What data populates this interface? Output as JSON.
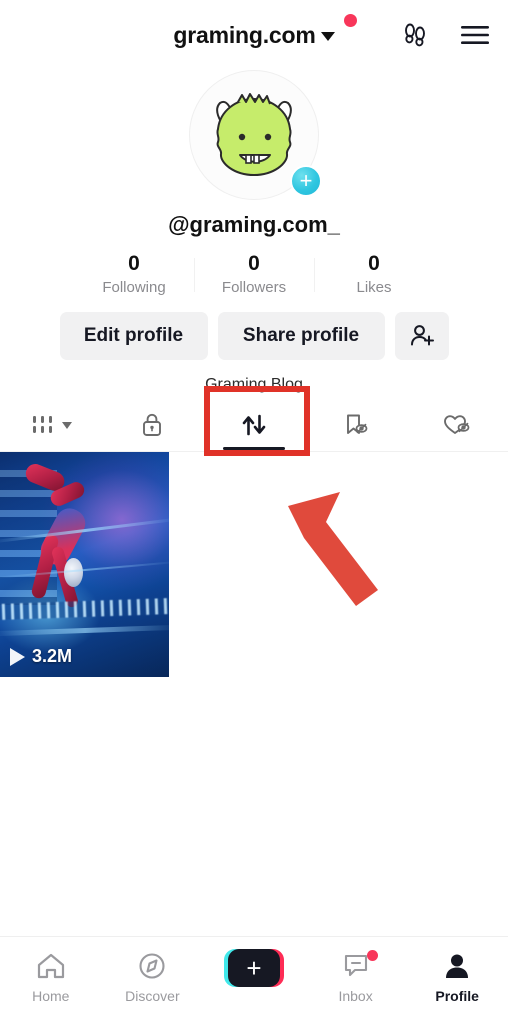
{
  "header": {
    "title": "graming.com",
    "chevron_icon": "chevron-down-icon",
    "notification_dot": true,
    "footprints_icon": "footprints-icon",
    "menu_icon": "hamburger-menu-icon"
  },
  "profile": {
    "avatar_icon": "monster-avatar",
    "add_badge_label": "+",
    "username": "@graming.com_",
    "stats": [
      {
        "value": "0",
        "label": "Following"
      },
      {
        "value": "0",
        "label": "Followers"
      },
      {
        "value": "0",
        "label": "Likes"
      }
    ],
    "actions": {
      "edit_label": "Edit profile",
      "share_label": "Share profile",
      "add_user_icon": "add-person-icon"
    }
  },
  "annotation": {
    "blog_label": "Graming Blog",
    "highlight_color": "#e03228",
    "arrow_color": "#e04a3c",
    "arrow_icon": "red-pointer-arrow"
  },
  "tabs": [
    {
      "id": "posts",
      "icon": "grid-bars-icon",
      "has_caret": true,
      "active": false
    },
    {
      "id": "private",
      "icon": "lock-icon",
      "has_caret": false,
      "active": false
    },
    {
      "id": "reposts",
      "icon": "repost-arrows-icon",
      "has_caret": false,
      "active": true
    },
    {
      "id": "saved",
      "icon": "bookmark-hidden-icon",
      "has_caret": false,
      "active": false
    },
    {
      "id": "liked",
      "icon": "heart-hidden-icon",
      "has_caret": false,
      "active": false
    }
  ],
  "grid": {
    "items": [
      {
        "thumbnail_icon": "spiderman-video-thumbnail",
        "play_count": "3.2M",
        "play_icon": "play-triangle-icon"
      }
    ]
  },
  "bottom_nav": [
    {
      "id": "home",
      "label": "Home",
      "icon": "home-icon",
      "active": false,
      "badge": false
    },
    {
      "id": "discover",
      "label": "Discover",
      "icon": "compass-icon",
      "active": false,
      "badge": false
    },
    {
      "id": "create",
      "label": "",
      "icon": "create-plus-icon",
      "active": false,
      "badge": false,
      "plus_label": "+"
    },
    {
      "id": "inbox",
      "label": "Inbox",
      "icon": "inbox-message-icon",
      "active": false,
      "badge": true
    },
    {
      "id": "profile",
      "label": "Profile",
      "icon": "person-filled-icon",
      "active": true,
      "badge": false
    }
  ],
  "colors": {
    "accent_pink": "#fe2c55",
    "accent_cyan": "#41e8ea",
    "badge_red": "#f8365a",
    "text_primary": "#161823",
    "text_muted": "#8a8a8e",
    "button_bg": "#f1f1f2"
  }
}
